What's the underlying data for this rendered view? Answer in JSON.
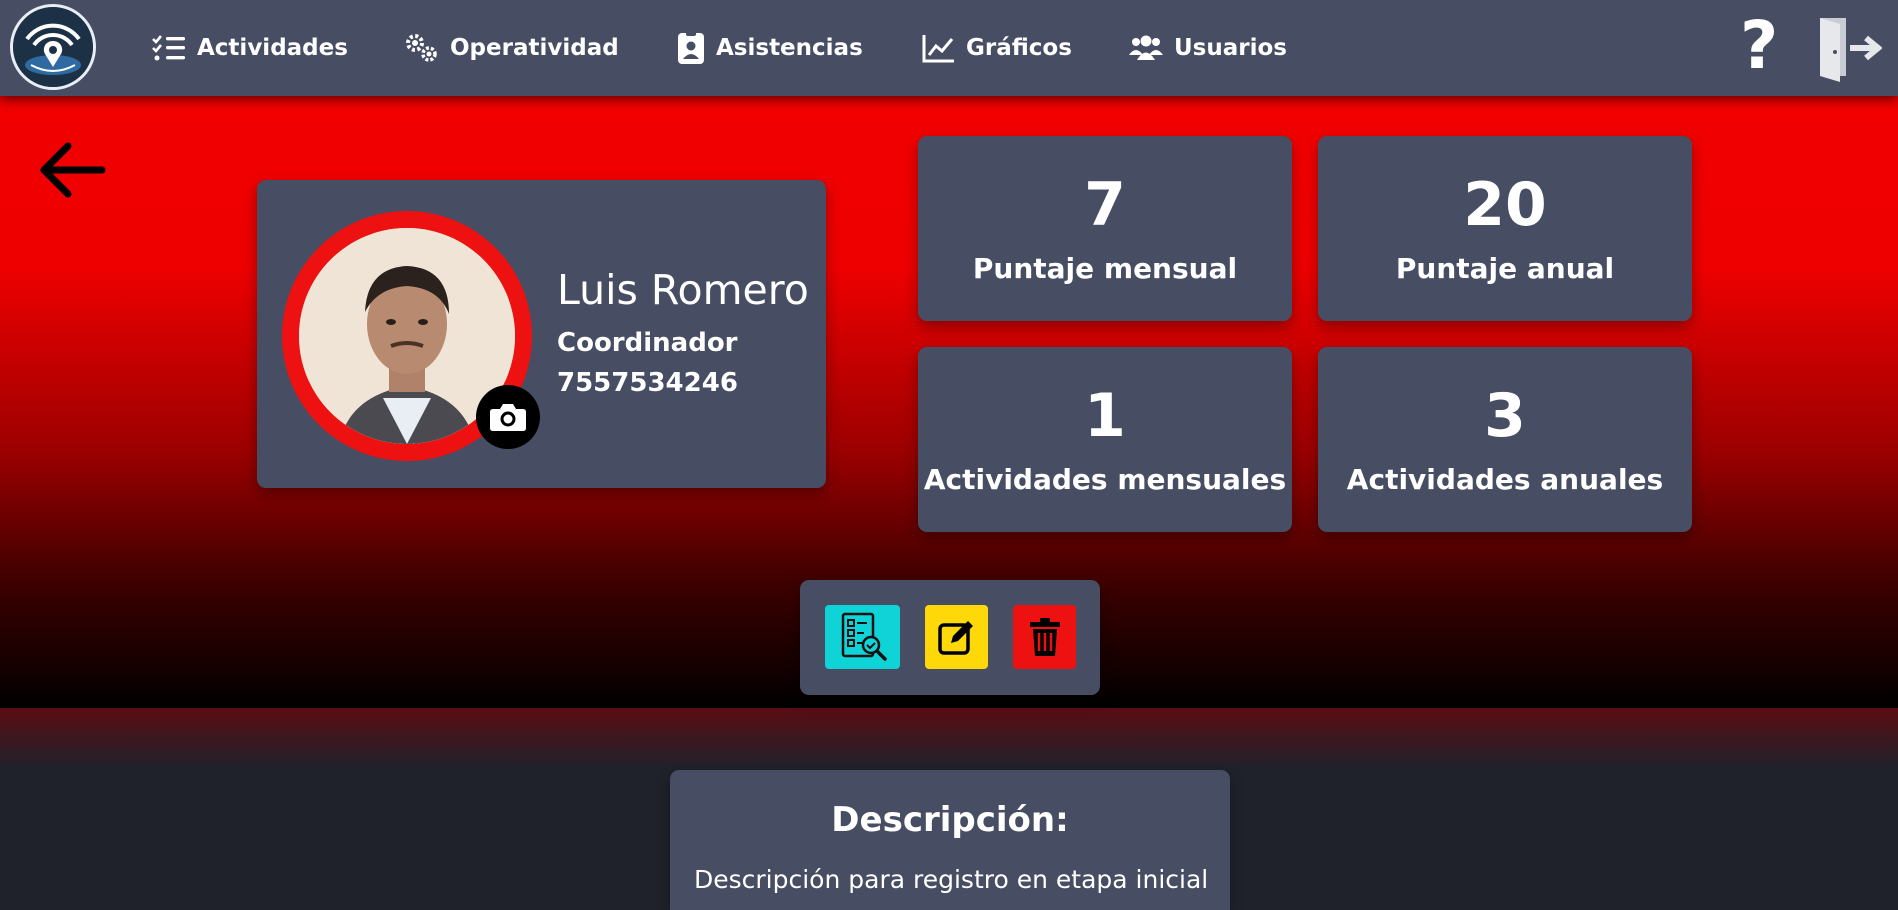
{
  "nav": {
    "items": [
      {
        "label": "Actividades",
        "icon": "checklist-icon"
      },
      {
        "label": "Operatividad",
        "icon": "gears-icon"
      },
      {
        "label": "Asistencias",
        "icon": "id-badge-icon"
      },
      {
        "label": "Gráficos",
        "icon": "line-chart-icon"
      },
      {
        "label": "Usuarios",
        "icon": "users-icon"
      }
    ],
    "help_label": "?",
    "colors": {
      "bar": "#474d62",
      "text": "#ffffff"
    }
  },
  "profile": {
    "name": "Luis Romero",
    "role": "Coordinador",
    "phone": "7557534246"
  },
  "stats": [
    {
      "value": "7",
      "label": "Puntaje mensual"
    },
    {
      "value": "20",
      "label": "Puntaje anual"
    },
    {
      "value": "1",
      "label": "Actividades mensuales"
    },
    {
      "value": "3",
      "label": "Actividades anuales"
    }
  ],
  "actions": {
    "colors": {
      "review": "#10d3d8",
      "edit": "#ffd80a",
      "delete": "#ee1111"
    }
  },
  "description": {
    "title": "Descripción:",
    "text": "Descripción para registro en etapa inicial"
  },
  "theme": {
    "hero_top": "#f20000",
    "hero_bottom": "#000000",
    "card": "#474d62",
    "page_bg": "#20222b"
  }
}
